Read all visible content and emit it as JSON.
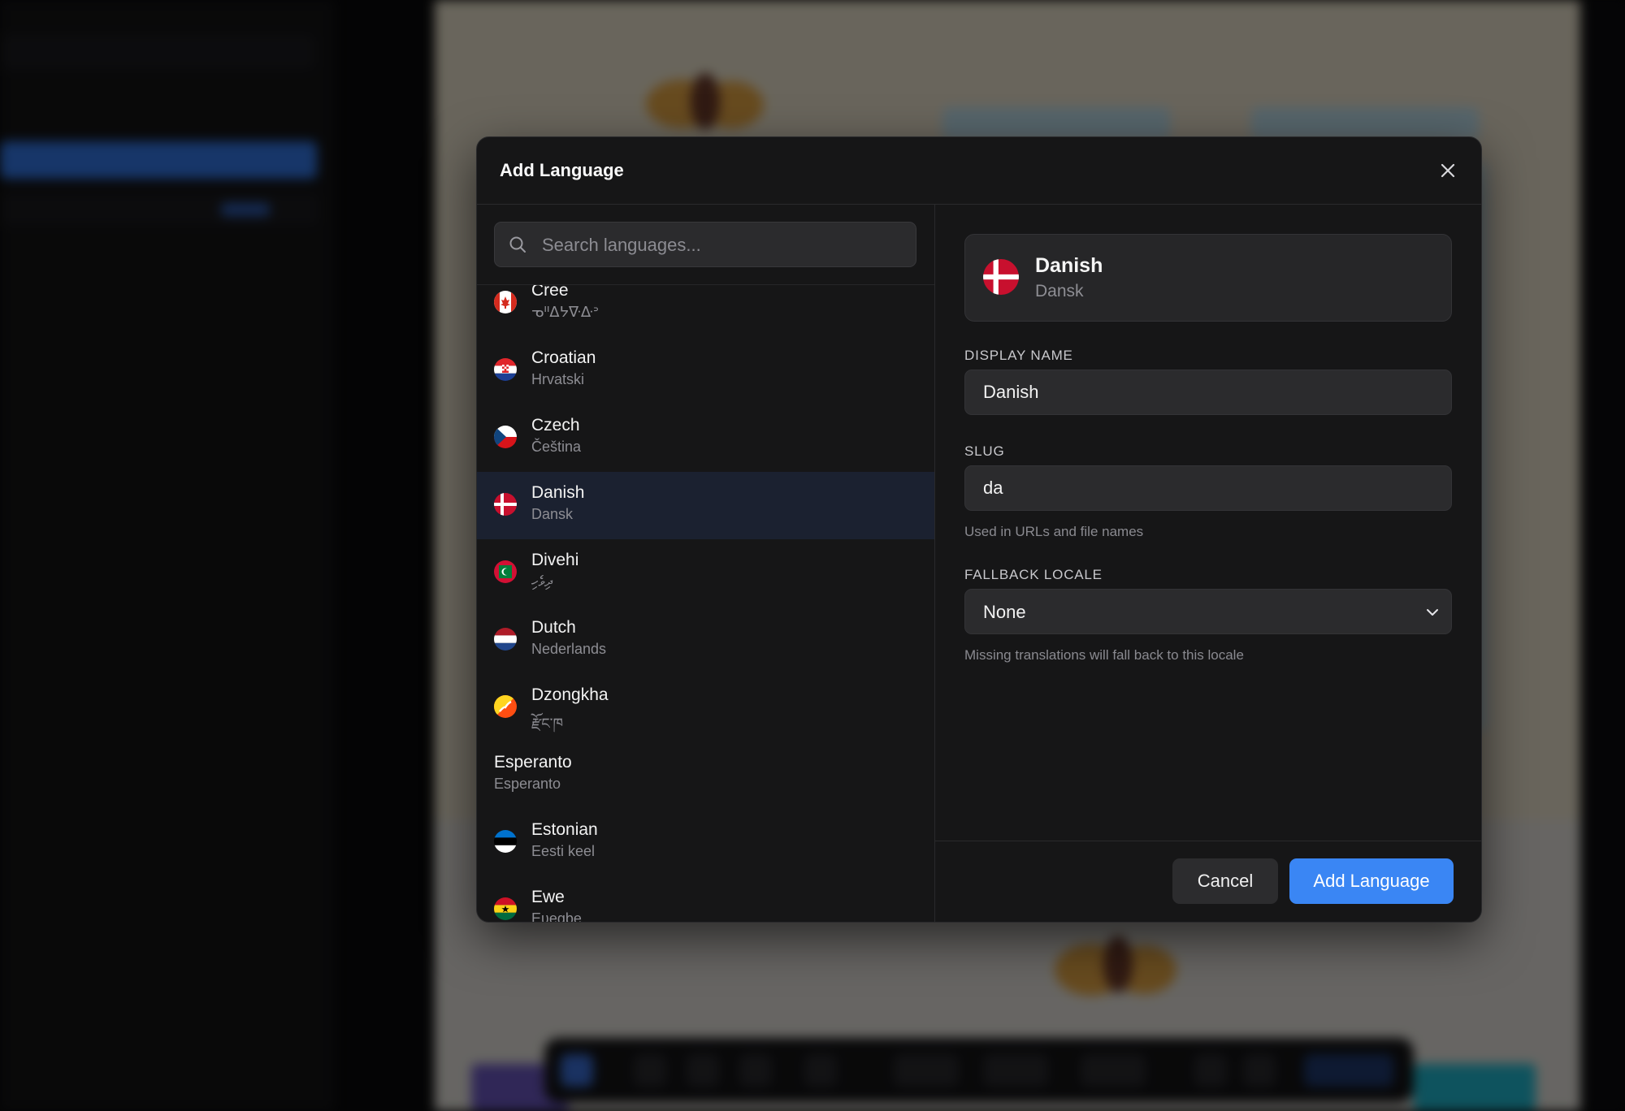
{
  "modal": {
    "title": "Add Language"
  },
  "search": {
    "placeholder": "Search languages..."
  },
  "languages": [
    {
      "name": "Cree",
      "native": "ᓀᐦᐃᔭᐍᐏᐣ",
      "flag": "canada"
    },
    {
      "name": "Croatian",
      "native": "Hrvatski",
      "flag": "croatia"
    },
    {
      "name": "Czech",
      "native": "Čeština",
      "flag": "czech"
    },
    {
      "name": "Danish",
      "native": "Dansk",
      "flag": "denmark",
      "selected": true
    },
    {
      "name": "Divehi",
      "native": "ދިވެހި",
      "flag": "maldives"
    },
    {
      "name": "Dutch",
      "native": "Nederlands",
      "flag": "netherlands"
    },
    {
      "name": "Dzongkha",
      "native": "རྫོང་ཁ",
      "flag": "bhutan"
    },
    {
      "name": "Esperanto",
      "native": "Esperanto",
      "flag": ""
    },
    {
      "name": "Estonian",
      "native": "Eesti keel",
      "flag": "estonia"
    },
    {
      "name": "Ewe",
      "native": "Eʋegbe",
      "flag": "ghana"
    }
  ],
  "preview": {
    "name": "Danish",
    "native": "Dansk",
    "flag": "denmark"
  },
  "form": {
    "display_name_label": "DISPLAY NAME",
    "display_name_value": "Danish",
    "slug_label": "SLUG",
    "slug_value": "da",
    "slug_help": "Used in URLs and file names",
    "fallback_label": "FALLBACK LOCALE",
    "fallback_value": "None",
    "fallback_help": "Missing translations will fall back to this locale"
  },
  "buttons": {
    "cancel": "Cancel",
    "add": "Add Language"
  },
  "colors": {
    "accent": "#3a86f4",
    "modal_bg": "#161617",
    "selected_row": "#1b2130"
  },
  "icons": {
    "close": "close-icon",
    "search": "search-icon",
    "chevron": "chevron-down-icon"
  }
}
